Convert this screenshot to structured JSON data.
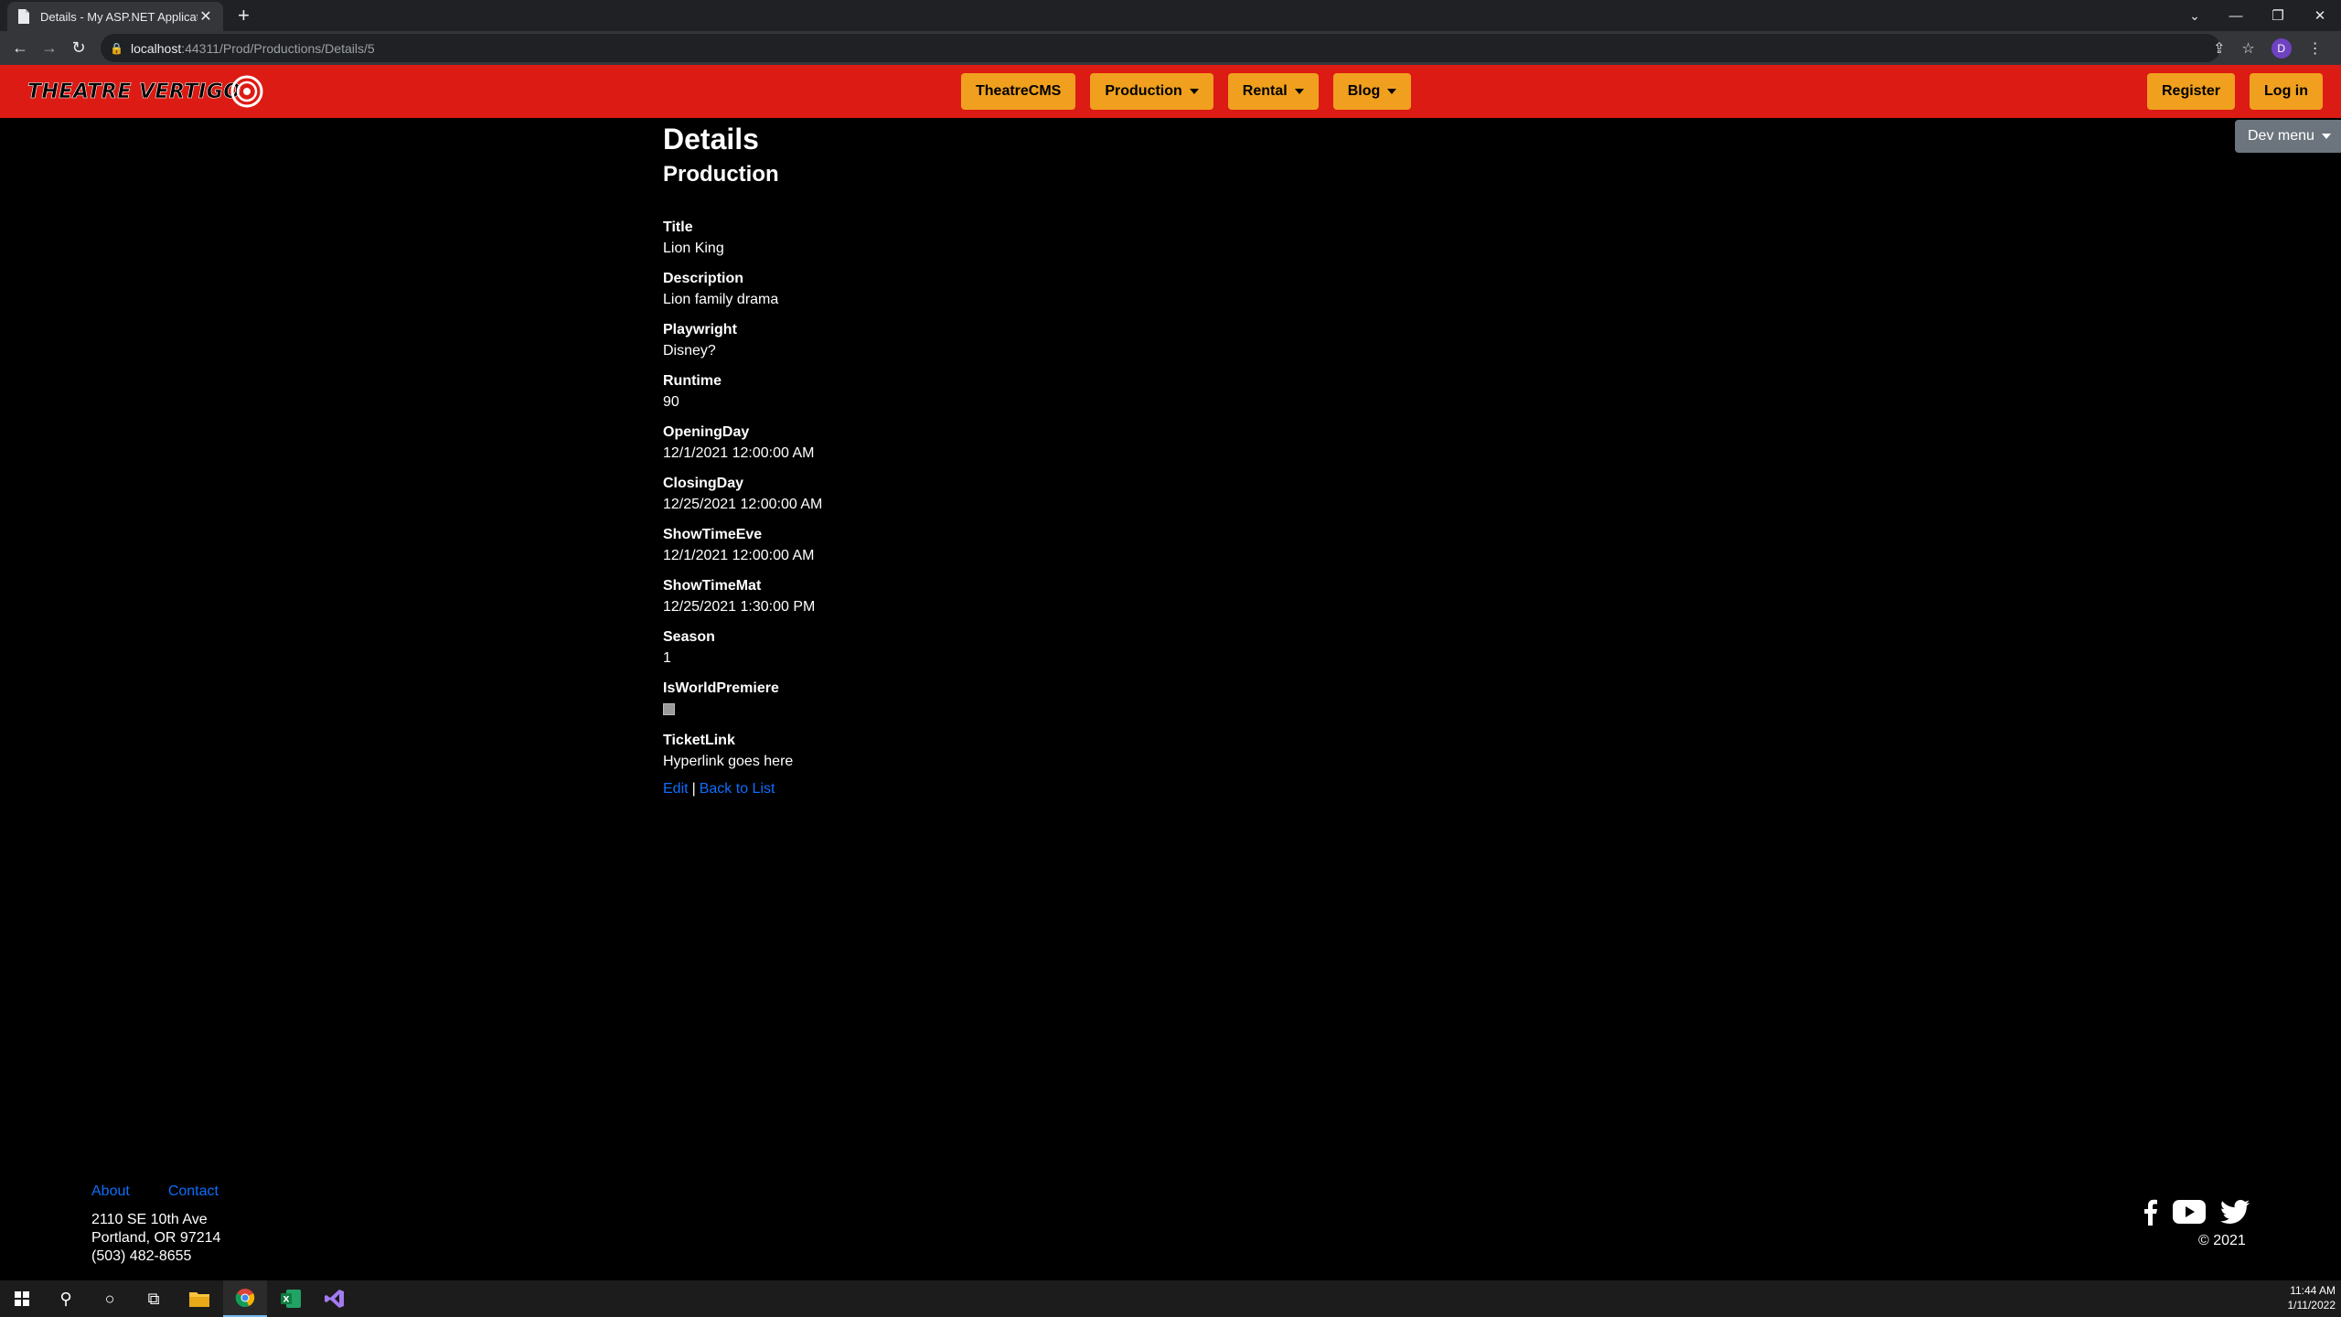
{
  "browser": {
    "tab_title": "Details - My ASP.NET Application",
    "new_tab": "+",
    "url_host": "localhost",
    "url_rest": ":44311/Prod/Productions/Details/5",
    "profile_initial": "D"
  },
  "navbar": {
    "brand": "THEATRE VERTIGO",
    "items": [
      {
        "label": "TheatreCMS",
        "dropdown": false
      },
      {
        "label": "Production",
        "dropdown": true
      },
      {
        "label": "Rental",
        "dropdown": true
      },
      {
        "label": "Blog",
        "dropdown": true
      }
    ],
    "register_label": "Register",
    "login_label": "Log in",
    "bar_color": "#dc1b14",
    "button_color": "#f0a01e"
  },
  "dev_menu": {
    "label": "Dev menu"
  },
  "page": {
    "title": "Details",
    "subtitle": "Production",
    "fields": [
      {
        "label": "Title",
        "value": "Lion King"
      },
      {
        "label": "Description",
        "value": "Lion family drama"
      },
      {
        "label": "Playwright",
        "value": "Disney?"
      },
      {
        "label": "Runtime",
        "value": "90"
      },
      {
        "label": "OpeningDay",
        "value": "12/1/2021 12:00:00 AM"
      },
      {
        "label": "ClosingDay",
        "value": "12/25/2021 12:00:00 AM"
      },
      {
        "label": "ShowTimeEve",
        "value": "12/1/2021 12:00:00 AM"
      },
      {
        "label": "ShowTimeMat",
        "value": "12/25/2021 1:30:00 PM"
      },
      {
        "label": "Season",
        "value": "1"
      },
      {
        "label": "IsWorldPremiere",
        "checkbox": false
      },
      {
        "label": "TicketLink",
        "value": "Hyperlink goes here"
      }
    ],
    "edit_label": "Edit",
    "separator": "|",
    "back_label": "Back to List"
  },
  "footer": {
    "about_label": "About",
    "contact_label": "Contact",
    "address_line1": "2110 SE 10th Ave",
    "address_line2": "Portland, OR 97214",
    "phone": "(503) 482-8655",
    "copyright": "© 2021"
  },
  "taskbar": {
    "time": "11:44 AM",
    "date": "1/11/2022"
  }
}
